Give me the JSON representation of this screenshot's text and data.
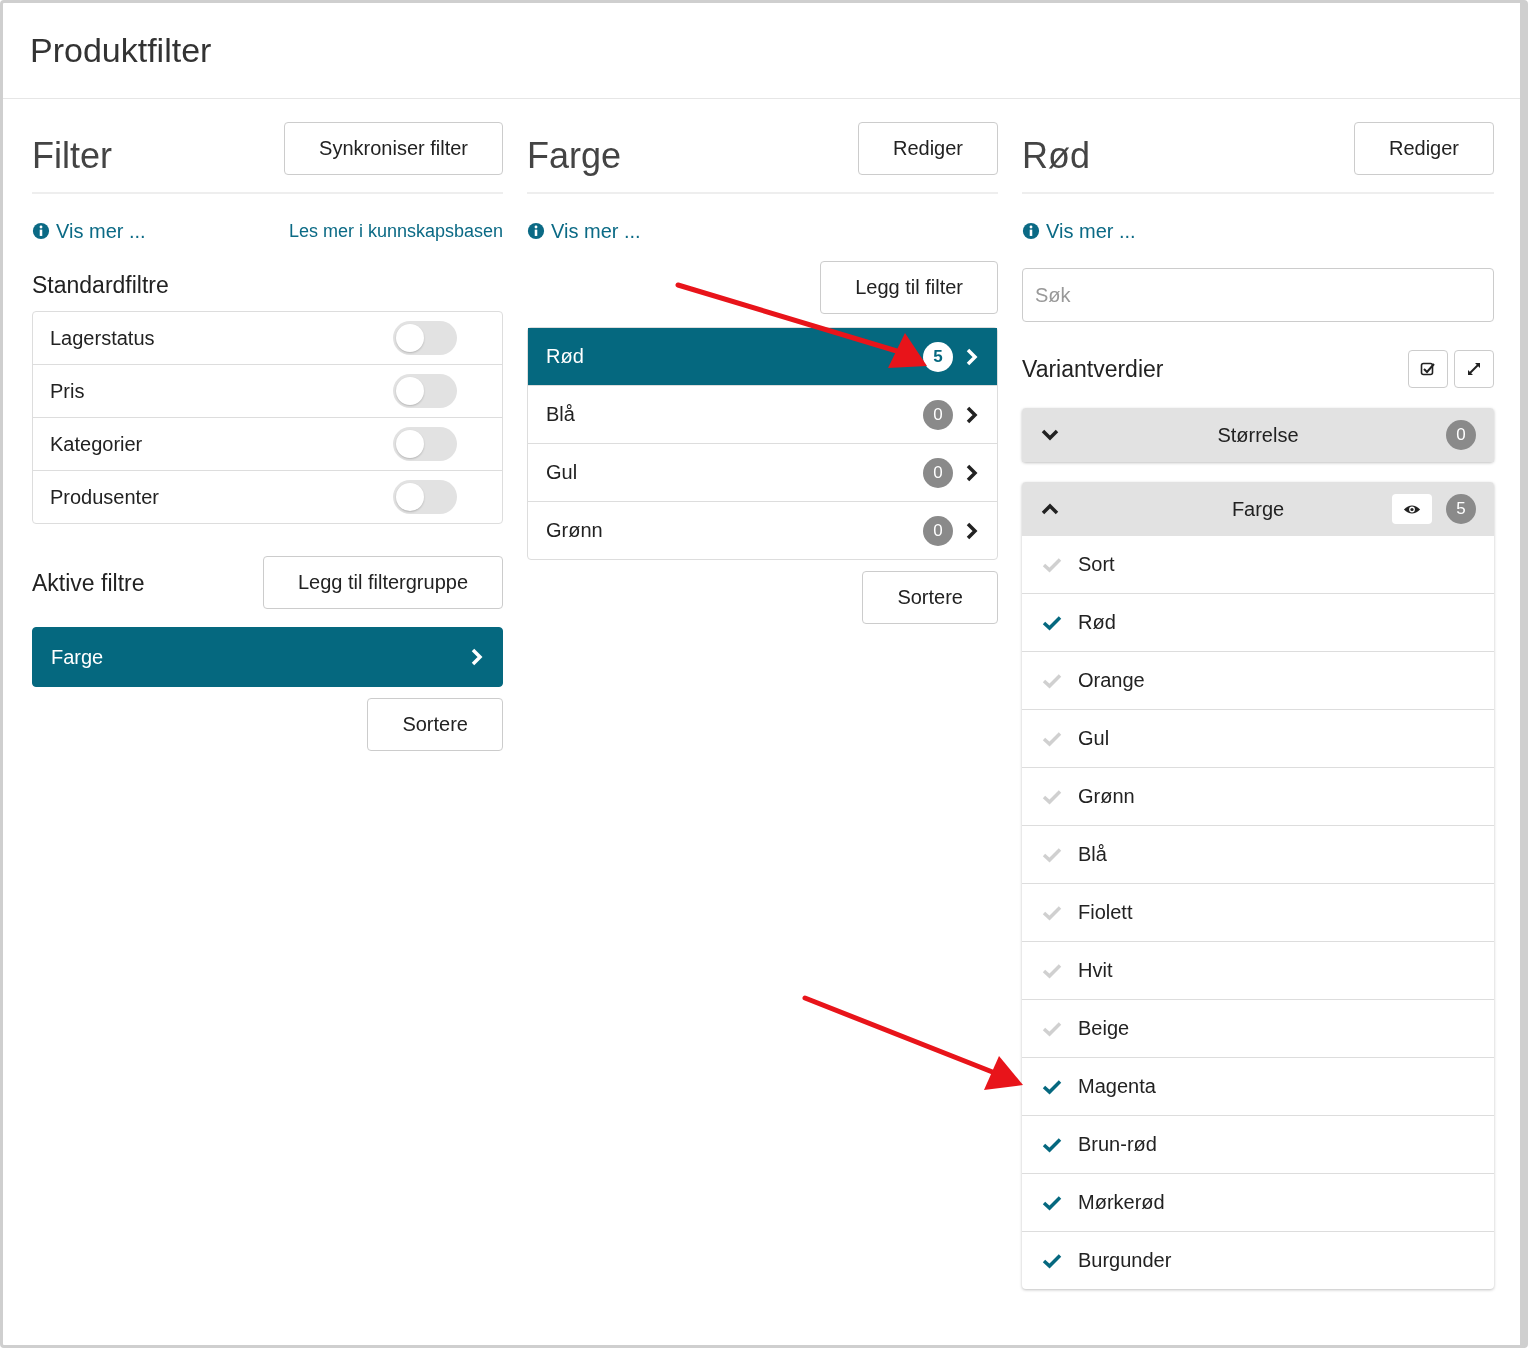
{
  "page": {
    "title": "Produktfilter"
  },
  "filter_panel": {
    "title": "Filter",
    "sync_button": "Synkroniser filter",
    "info_link": "Vis mer ...",
    "kb_link": "Les mer i kunnskapsbasen",
    "standard_heading": "Standardfiltre",
    "standard_filters": [
      {
        "label": "Lagerstatus",
        "on": false
      },
      {
        "label": "Pris",
        "on": false
      },
      {
        "label": "Kategorier",
        "on": false
      },
      {
        "label": "Produsenter",
        "on": false
      }
    ],
    "active_heading": "Aktive filtre",
    "add_group_button": "Legg til filtergruppe",
    "active_filters": [
      {
        "label": "Farge",
        "selected": true
      }
    ],
    "sort_button": "Sortere"
  },
  "group_panel": {
    "title": "Farge",
    "edit_button": "Rediger",
    "info_link": "Vis mer ...",
    "add_filter_button": "Legg til filter",
    "filters": [
      {
        "label": "Rød",
        "count": "5",
        "selected": true
      },
      {
        "label": "Blå",
        "count": "0",
        "selected": false
      },
      {
        "label": "Gul",
        "count": "0",
        "selected": false
      },
      {
        "label": "Grønn",
        "count": "0",
        "selected": false
      }
    ],
    "sort_button": "Sortere"
  },
  "value_panel": {
    "title": "Rød",
    "edit_button": "Rediger",
    "info_link": "Vis mer ...",
    "search": {
      "placeholder": "Søk"
    },
    "variants_heading": "Variantverdier",
    "groups": [
      {
        "label": "Størrelse",
        "count": "0",
        "expanded": false,
        "eye_button": false
      },
      {
        "label": "Farge",
        "count": "5",
        "expanded": true,
        "eye_button": true,
        "values": [
          {
            "label": "Sort",
            "checked": false
          },
          {
            "label": "Rød",
            "checked": true
          },
          {
            "label": "Orange",
            "checked": false
          },
          {
            "label": "Gul",
            "checked": false
          },
          {
            "label": "Grønn",
            "checked": false
          },
          {
            "label": "Blå",
            "checked": false
          },
          {
            "label": "Fiolett",
            "checked": false
          },
          {
            "label": "Hvit",
            "checked": false
          },
          {
            "label": "Beige",
            "checked": false
          },
          {
            "label": "Magenta",
            "checked": true
          },
          {
            "label": "Brun-rød",
            "checked": true
          },
          {
            "label": "Mørkerød",
            "checked": true
          },
          {
            "label": "Burgunder",
            "checked": true
          }
        ]
      }
    ]
  }
}
